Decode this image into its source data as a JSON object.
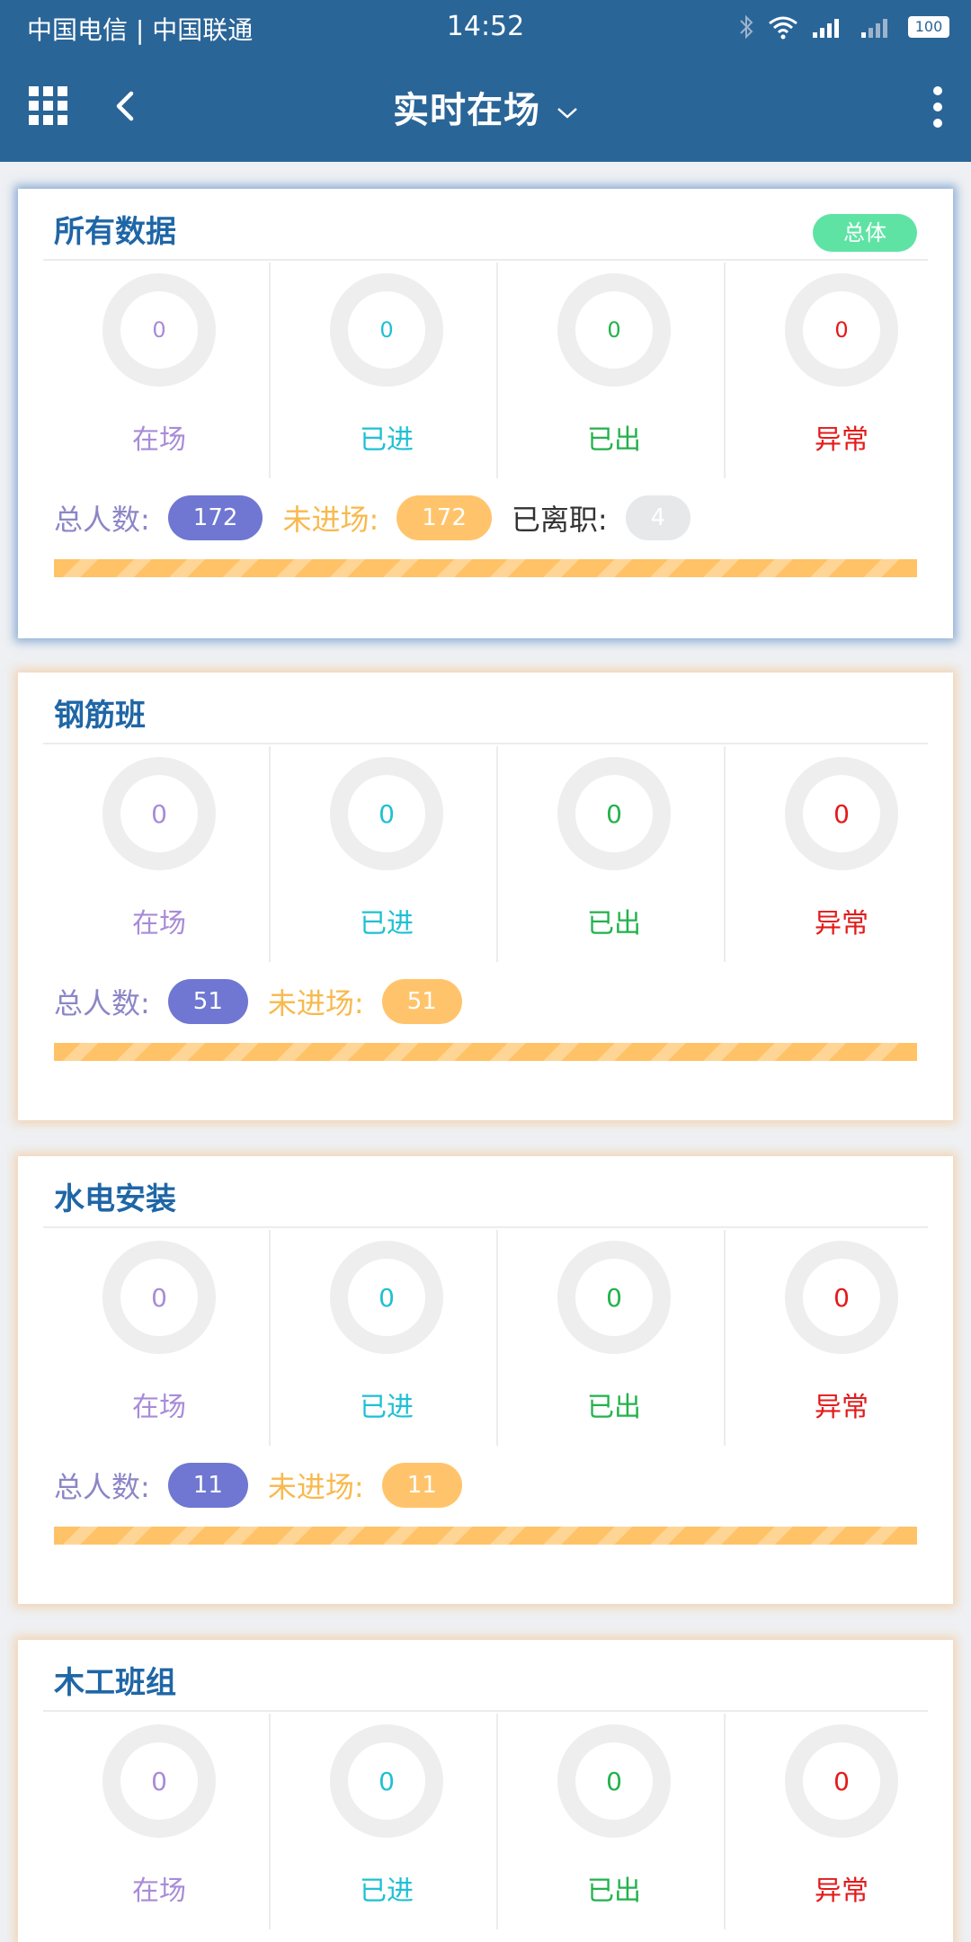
{
  "status_bar": {
    "carrier": "中国电信 | 中国联通",
    "time": "14:52",
    "battery": "100"
  },
  "app_bar": {
    "title": "实时在场"
  },
  "labels": {
    "on_site": "在场",
    "entered": "已进",
    "exited": "已出",
    "abnormal": "异常",
    "total": "总人数:",
    "not_entered": "未进场:",
    "resigned": "已离职:"
  },
  "colors": {
    "primary": "#2a6598",
    "on_site": "#a88bd8",
    "entered": "#1fc0d4",
    "exited": "#22b24c",
    "abnormal": "#e41a1a",
    "total_pill": "#6f77d3",
    "pending_pill": "#ffc46b",
    "overall_badge": "#5fe3a5"
  },
  "cards": [
    {
      "title": "所有数据",
      "badge": "总体",
      "on_site": "0",
      "entered": "0",
      "exited": "0",
      "abnormal": "0",
      "total": "172",
      "not_entered": "172",
      "resigned": "4"
    },
    {
      "title": "钢筋班",
      "on_site": "0",
      "entered": "0",
      "exited": "0",
      "abnormal": "0",
      "total": "51",
      "not_entered": "51"
    },
    {
      "title": "水电安装",
      "on_site": "0",
      "entered": "0",
      "exited": "0",
      "abnormal": "0",
      "total": "11",
      "not_entered": "11"
    },
    {
      "title": "木工班组",
      "on_site": "0",
      "entered": "0",
      "exited": "0",
      "abnormal": "0"
    }
  ]
}
